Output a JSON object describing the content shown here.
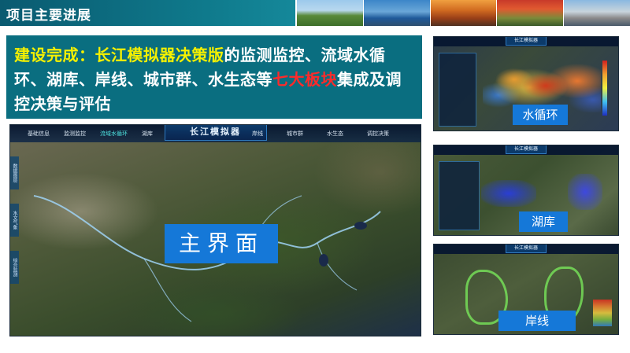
{
  "header": {
    "title": "项目主要进展"
  },
  "headline": {
    "part1": "建设完成：长江模拟器决策版",
    "part2": "的监测监控、流域水循环、湖库、岸线、城市群、水生态等",
    "part3": "七大板块",
    "part4": "集成及调控决策与评估"
  },
  "main_screen": {
    "brand": "长江模拟器",
    "tabs_left": [
      "基础信息",
      "监测监控",
      "流域水循环",
      "湖库"
    ],
    "active_tab": "流域水循环",
    "tabs_right": [
      "岸线",
      "城市群",
      "水生态",
      "调控决策"
    ],
    "side_tabs": [
      "数据图层",
      "水文气象",
      "综合监测"
    ],
    "label": "主界面"
  },
  "thumbnails": [
    {
      "brand": "长江模拟器",
      "label": "水循环"
    },
    {
      "brand": "长江模拟器",
      "label": "湖库"
    },
    {
      "brand": "长江模拟器",
      "label": "岸线"
    }
  ],
  "colors": {
    "header_bg": "#0f7a8c",
    "headline_bg": "#0a6e80",
    "highlight_yellow": "#f5f000",
    "highlight_red": "#ff2a2a",
    "label_bg": "#1578d8"
  }
}
